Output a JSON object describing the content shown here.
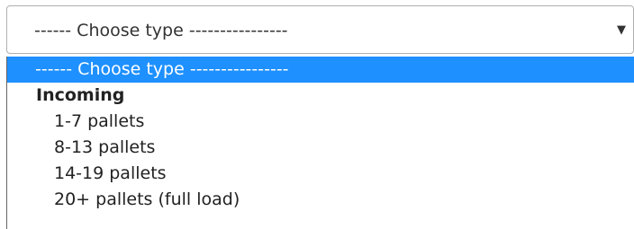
{
  "select": {
    "selected_label": "------ Choose type ----------------",
    "arrow_icon": "caret-down-icon"
  },
  "dropdown": {
    "placeholder_option": "------ Choose type ----------------",
    "groups": [
      {
        "label": "Incoming",
        "options": [
          "1-7 pallets",
          "8-13 pallets",
          "14-19 pallets",
          "20+ pallets (full load)"
        ]
      }
    ]
  },
  "colors": {
    "highlight": "#1e90ff",
    "border": "#b0b0b0"
  }
}
